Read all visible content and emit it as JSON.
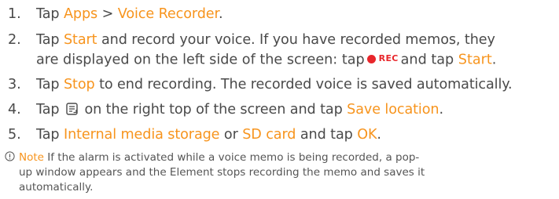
{
  "colors": {
    "accent": "#f7941d",
    "text": "#4a4a4a",
    "rec": "#e8262b"
  },
  "steps": [
    {
      "num": "1.",
      "t1": "Tap ",
      "h1": "Apps",
      "t2": " > ",
      "h2": "Voice Recorder",
      "t3": "."
    },
    {
      "num": "2.",
      "t1": "Tap ",
      "h1": "Start",
      "t2": " and record your voice. If you have recorded memos, they",
      "c1": "are displayed on the left side of the screen: tap",
      "rec_label": "REC",
      "c2": "and tap ",
      "h2": "Start",
      "c3": "."
    },
    {
      "num": "3.",
      "t1": "Tap ",
      "h1": "Stop",
      "t2": " to end recording. The recorded voice is saved automatically."
    },
    {
      "num": "4.",
      "t1": "Tap ",
      "icon": "menu-icon",
      "t2": " on the right top of the screen and tap ",
      "h1": "Save location",
      "t3": "."
    },
    {
      "num": "5.",
      "t1": "Tap ",
      "h1": "Internal media storage",
      "t2": " or ",
      "h2": "SD card",
      "t3": " and tap ",
      "h3": "OK",
      "t4": "."
    }
  ],
  "note": {
    "icon": "info-icon",
    "label": "Note",
    "line1": " If the alarm is activated while a voice memo is being recorded, a pop-",
    "line2": "up window appears and the Element stops recording the memo and saves it",
    "line3": "automatically."
  }
}
